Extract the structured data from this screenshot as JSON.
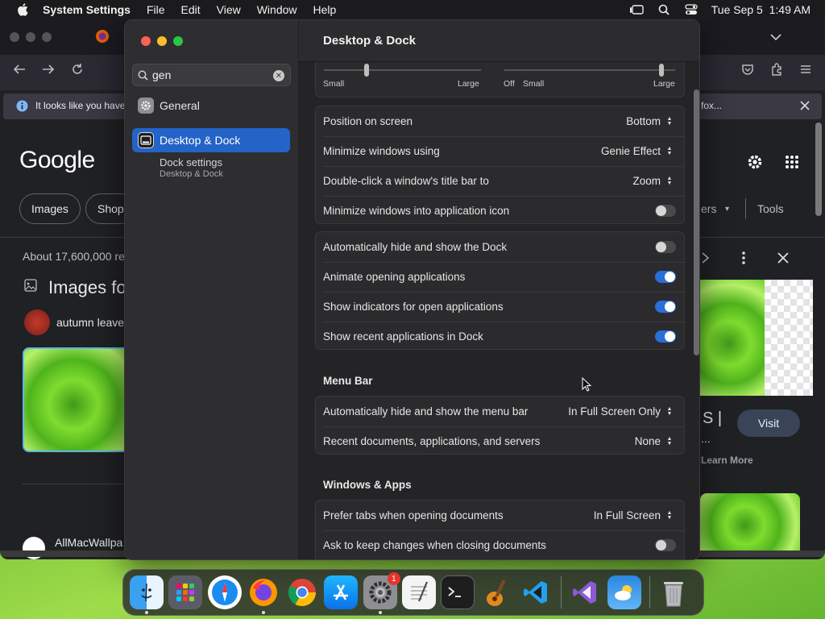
{
  "menubar": {
    "app_name": "System Settings",
    "items": [
      "File",
      "Edit",
      "View",
      "Window",
      "Help"
    ],
    "datetime": "Tue Sep 5  1:49 AM"
  },
  "browser": {
    "notice_text": "It looks like you have",
    "notice_right": "fox...",
    "logo": "Google",
    "chip_images": "Images",
    "chip_shop": "Shop",
    "results_count": "About 17,600,000 re",
    "images_heading": "Images fo",
    "autumn_label": "autumn leave",
    "filters_label": "ers",
    "tools_label": "Tools",
    "visit_label": "Visit",
    "learn_more": "Learn More",
    "site_s": "S |",
    "ellipsis": "...",
    "allmac": "AllMacWallpa"
  },
  "settings": {
    "search_value": "gen",
    "sidebar": {
      "general": "General",
      "desktop_dock": "Desktop & Dock",
      "dock_settings": "Dock settings",
      "dock_settings_sub": "Desktop & Dock"
    },
    "title": "Desktop & Dock",
    "sliders": {
      "small_1": "Small",
      "large_1": "Large",
      "off": "Off",
      "small_2": "Small",
      "large_2": "Large"
    },
    "dock_group": [
      {
        "label": "Position on screen",
        "value": "Bottom"
      },
      {
        "label": "Minimize windows using",
        "value": "Genie Effect"
      },
      {
        "label": "Double-click a window's title bar to",
        "value": "Zoom"
      },
      {
        "label": "Minimize windows into application icon",
        "toggle": false
      }
    ],
    "toggle_group": [
      {
        "label": "Automatically hide and show the Dock",
        "toggle": false
      },
      {
        "label": "Animate opening applications",
        "toggle": true
      },
      {
        "label": "Show indicators for open applications",
        "toggle": true
      },
      {
        "label": "Show recent applications in Dock",
        "toggle": true
      }
    ],
    "menu_bar_section": "Menu Bar",
    "menu_bar_group": [
      {
        "label": "Automatically hide and show the menu bar",
        "value": "In Full Screen Only"
      },
      {
        "label": "Recent documents, applications, and servers",
        "value": "None"
      }
    ],
    "windows_section": "Windows & Apps",
    "windows_group": [
      {
        "label": "Prefer tabs when opening documents",
        "value": "In Full Screen"
      },
      {
        "label": "Ask to keep changes when closing documents",
        "toggle": false
      }
    ]
  },
  "dock": {
    "apps": [
      "Finder",
      "Launchpad",
      "Safari",
      "Firefox",
      "Chrome",
      "App Store",
      "System Settings",
      "TextEdit",
      "Terminal",
      "GarageBand",
      "VS Code"
    ],
    "recent": [
      "Visual Studio",
      "Weather"
    ],
    "trash": "Trash",
    "settings_badge": "1",
    "colors": {
      "accent": "#2463c7",
      "toggle_on": "#2a6fd6"
    }
  }
}
